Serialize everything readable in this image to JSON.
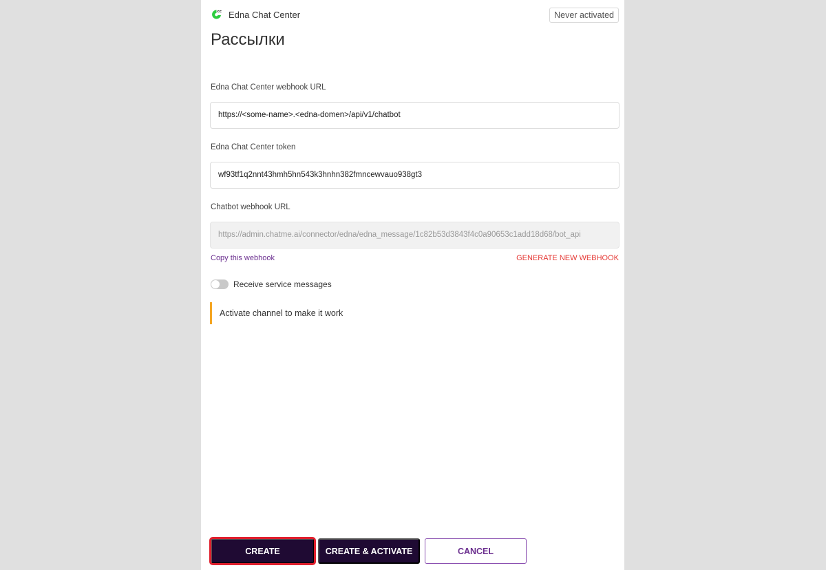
{
  "header": {
    "brand_name": "Edna Chat Center",
    "status_badge": "Never activated"
  },
  "page": {
    "title": "Рассылки"
  },
  "fields": [
    {
      "label": "Edna Chat Center webhook URL",
      "value": "https://<some-name>.<edna-domen>/api/v1/chatbot",
      "disabled": false
    },
    {
      "label": "Edna Chat Center token",
      "value": "wf93tf1q2nnt43hmh5hn543k3hnhn382fmncewvauo938gt3",
      "disabled": false
    },
    {
      "label": "Chatbot webhook URL",
      "value": "https://admin.chatme.ai/connector/edna/edna_message/1c82b53d3843f4c0a90653c1add18d68/bot_api",
      "disabled": true
    }
  ],
  "links": {
    "copy_webhook": "Copy this webhook",
    "generate_webhook": "GENERATE NEW WEBHOOK"
  },
  "toggle": {
    "label": "Receive service messages",
    "checked": false
  },
  "notice": {
    "text": "Activate channel to make it work"
  },
  "buttons": {
    "create": "CREATE",
    "create_activate": "CREATE & ACTIVATE",
    "cancel": "CANCEL"
  },
  "colors": {
    "brand_accent": "#2ecc40",
    "primary_button": "#1f0a33",
    "highlight_outline": "#e0202e",
    "link_purple": "#6b2f8f",
    "danger_red": "#e53935",
    "notice_accent": "#f5a623"
  },
  "icons": {
    "brand": "edna-logo-icon"
  }
}
